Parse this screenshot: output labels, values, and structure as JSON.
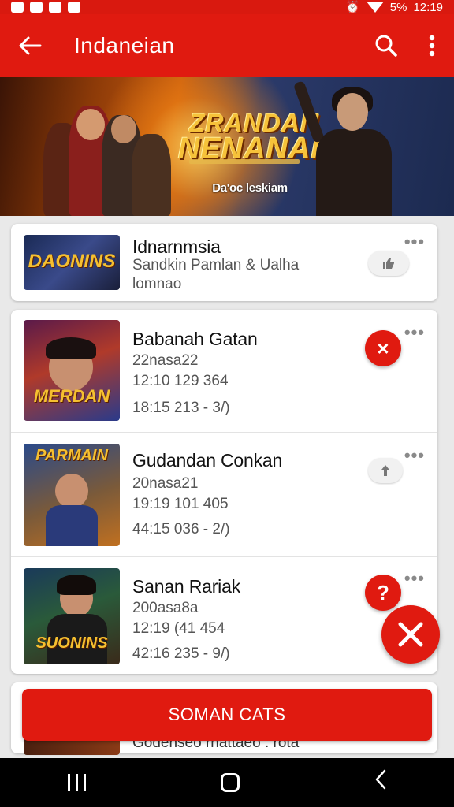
{
  "status_bar": {
    "battery": "5%",
    "time": "12:19"
  },
  "app_bar": {
    "title": "Indaneian"
  },
  "banner": {
    "logo_line1": "ZRANDAN",
    "logo_line2": "NENANAN",
    "caption": "Da'oc leskiam"
  },
  "items": [
    {
      "title": "Idnarnmsia",
      "line1": "Sandkin Pamlan & Ualha",
      "line2": "lomnao",
      "thumb_word": "DAONINS",
      "action_icon": "thumbs-up-icon"
    },
    {
      "title": "Babanah Gatan",
      "line1": "22nasa22",
      "line2": "12:10 129 364",
      "line3": "18:15 213 - 3/)",
      "thumb_word": "MERDAN",
      "action_label": "×"
    },
    {
      "title": "Gudandan Conkan",
      "line1": "20nasa21",
      "line2": "19:19 101 405",
      "line3": "44:15 036 - 2/)",
      "thumb_word": "PARMAIN",
      "action_icon": "upload-icon"
    },
    {
      "title": "Sanan Rariak",
      "line1": "200asa8a",
      "line2": "12:19 (41 454",
      "line3": "42:16 235 - 9/)",
      "thumb_word": "SUONINS",
      "action_label": "?"
    }
  ],
  "cta": {
    "label": "SOMAN CATS"
  },
  "peek": {
    "text": "Godenseo rnattaeo . rota"
  },
  "colors": {
    "primary": "#e01a10",
    "status_bar": "#d9190f"
  }
}
